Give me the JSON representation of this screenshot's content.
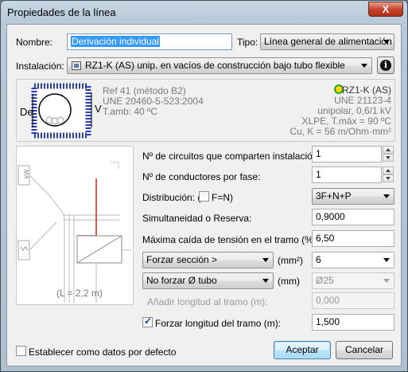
{
  "window": {
    "title": "Propiedades de la línea",
    "close_label": "X"
  },
  "nombre": {
    "label": "Nombre:",
    "value": "Derivación individual"
  },
  "tipo": {
    "label": "Tipo:",
    "value": "Línea general de alimentación"
  },
  "instalacion": {
    "label": "Instalación:",
    "value": "RZ1-K (AS) unip. en vacíos de construcción bajo tubo flexible",
    "info_label": "i"
  },
  "cable_info": {
    "ref": "Ref 41 (método B2)",
    "norma": "UNE 20460-5-523:2004",
    "tamb": "T.amb: 40 ºC",
    "de_label": "De",
    "v_label": "V",
    "cable": "RZ1-K (AS)",
    "cable_norma": "UNE 21123-4",
    "tipo_cable": "unipolar, 0,6/1 kV",
    "aislamiento": "XLPE, T.máx = 90 ºC",
    "conductor": "Cu, K = 56 m/Ohm·mm²"
  },
  "diagram": {
    "length_label": "(L = 2,2 m)",
    "kw_label": "kW"
  },
  "fields": {
    "circuitos": {
      "label": "Nº de circuitos que comparten instalación:",
      "value": "1"
    },
    "conductores": {
      "label": "Nº de conductores por fase:",
      "value": "1"
    },
    "distribucion": {
      "label_pre": "Distribución: (",
      "check_label": "F=N)",
      "value": "3F+N+P"
    },
    "simultaneidad": {
      "label": "Simultaneidad o Reserva:",
      "value": "0,9000"
    },
    "caida": {
      "label": "Máxima caída de tensión en el tramo (%):",
      "value": "6,50"
    },
    "seccion": {
      "mode": "Forzar sección >",
      "unit": "(mm²)",
      "value": "6"
    },
    "tubo": {
      "mode": "No forzar Ø tubo",
      "unit": "(mm)",
      "value": "Ø25"
    },
    "anadir": {
      "label": "Añadir longitud al tramo (m):",
      "value": "0,000"
    },
    "forzar_longitud": {
      "label": "Forzar longitud del tramo (m):",
      "value": "1,500",
      "checked": true
    }
  },
  "footer": {
    "defecto_label": "Establecer como datos por defecto",
    "accept": "Aceptar",
    "cancel": "Cancelar"
  },
  "colors": {
    "accent_red": "#d42020",
    "selection_blue": "#3399ff"
  }
}
